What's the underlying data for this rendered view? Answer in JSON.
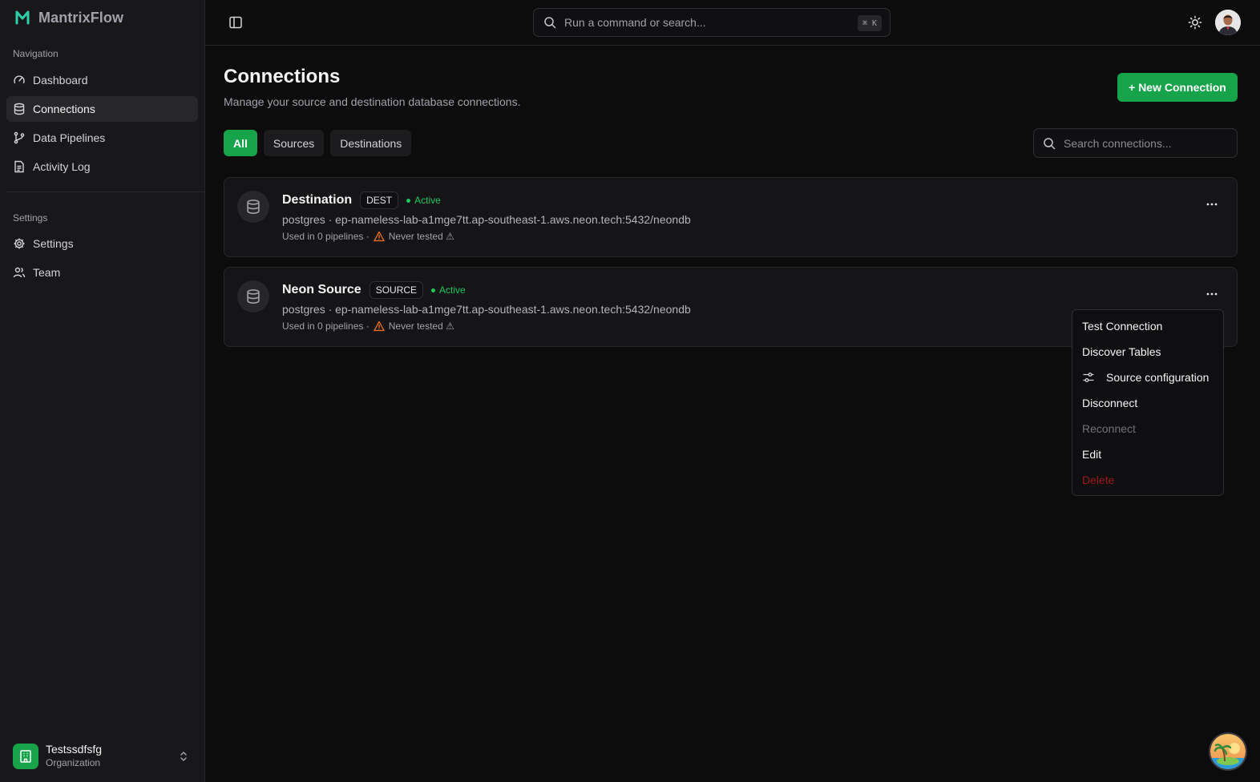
{
  "brand": {
    "name": "MantrixFlow",
    "logo_icon": "m-logo-icon",
    "logo_color": "#2ecfa6"
  },
  "sidebar": {
    "navigation_label": "Navigation",
    "nav_items": [
      {
        "label": "Dashboard",
        "icon": "gauge-icon"
      },
      {
        "label": "Connections",
        "icon": "database-icon",
        "active": true
      },
      {
        "label": "Data Pipelines",
        "icon": "git-branch-icon"
      },
      {
        "label": "Activity Log",
        "icon": "file-text-icon"
      }
    ],
    "settings_label": "Settings",
    "settings_items": [
      {
        "label": "Settings",
        "icon": "gear-icon"
      },
      {
        "label": "Team",
        "icon": "users-icon"
      }
    ],
    "org": {
      "name": "Testssdfsfg",
      "role": "Organization"
    }
  },
  "topbar": {
    "command_placeholder": "Run a command or search...",
    "shortcut": "⌘ K"
  },
  "page": {
    "title": "Connections",
    "subtitle": "Manage your source and destination database connections.",
    "new_button": "+ New Connection",
    "tabs": [
      "All",
      "Sources",
      "Destinations"
    ],
    "active_tab": "All",
    "search_placeholder": "Search connections..."
  },
  "connections": [
    {
      "name": "Destination",
      "badge": "DEST",
      "status": "Active",
      "url": "postgres · ep-nameless-lab-a1mge7tt.ap-southeast-1.aws.neon.tech:5432/neondb",
      "usage": "Used in 0 pipelines ·",
      "test_status": "Never tested ⚠"
    },
    {
      "name": "Neon Source",
      "badge": "SOURCE",
      "status": "Active",
      "url": "postgres · ep-nameless-lab-a1mge7tt.ap-southeast-1.aws.neon.tech:5432/neondb",
      "usage": "Used in 0 pipelines ·",
      "test_status": "Never tested ⚠"
    }
  ],
  "menu": {
    "items": [
      {
        "label": "Test Connection",
        "state": "normal"
      },
      {
        "label": "Discover Tables",
        "state": "normal"
      },
      {
        "label": "Source configuration",
        "state": "normal",
        "icon": "sliders-icon"
      },
      {
        "label": "Disconnect",
        "state": "normal"
      },
      {
        "label": "Reconnect",
        "state": "disabled"
      },
      {
        "label": "Edit",
        "state": "normal"
      },
      {
        "label": "Delete",
        "state": "danger"
      }
    ]
  },
  "colors": {
    "accent": "#16a34a",
    "status_active": "#22c55e",
    "warning": "#f97316",
    "danger": "#991b1b"
  }
}
